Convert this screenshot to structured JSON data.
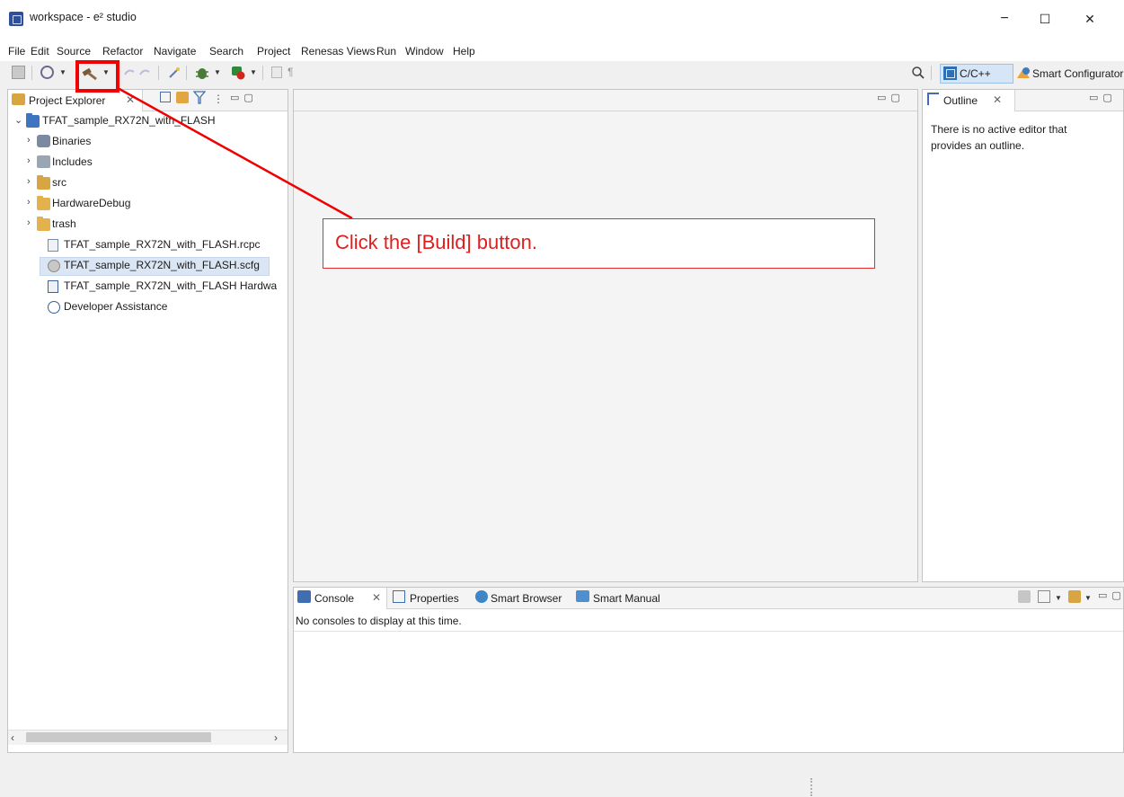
{
  "window": {
    "title": "workspace - e² studio",
    "controls": {
      "minimize": "−",
      "maximize": "☐",
      "close": "✕"
    }
  },
  "menu": [
    "File",
    "Edit",
    "Source",
    "Refactor",
    "Navigate",
    "Search",
    "Project",
    "Renesas Views",
    "Run",
    "Window",
    "Help"
  ],
  "toolbar": {
    "icons": [
      "save-icon",
      "manage-configurations-icon",
      "build-hammer-icon",
      "undo-icon",
      "redo-icon",
      "search-wand-icon",
      "debug-bug-icon",
      "run-icon",
      "pin-icon",
      "pilcrow-icon"
    ],
    "pilcrow": "¶",
    "perspective_cpp": "C/C++",
    "perspective_smart": "Smart Configurator",
    "colors": {
      "cpp_bg": "#d6e6f7",
      "accent": "#2f6fb3"
    }
  },
  "project_explorer": {
    "tab_label": "Project Explorer",
    "tree": {
      "root": "TFAT_sample_RX72N_with_FLASH",
      "items": [
        {
          "label": "Binaries",
          "icon": "binaries-icon",
          "expandable": true
        },
        {
          "label": "Includes",
          "icon": "includes-icon",
          "expandable": true
        },
        {
          "label": "src",
          "icon": "src-folder-icon",
          "expandable": true
        },
        {
          "label": "HardwareDebug",
          "icon": "folder-icon",
          "expandable": true
        },
        {
          "label": "trash",
          "icon": "folder-icon",
          "expandable": true
        },
        {
          "label": "TFAT_sample_RX72N_with_FLASH.rcpc",
          "icon": "file-icon",
          "expandable": false
        },
        {
          "label": "TFAT_sample_RX72N_with_FLASH.scfg",
          "icon": "gear-file-icon",
          "expandable": false,
          "selected": true
        },
        {
          "label": "TFAT_sample_RX72N_with_FLASH Hardwa",
          "icon": "launch-file-icon",
          "expandable": false
        },
        {
          "label": "Developer Assistance",
          "icon": "help-icon",
          "expandable": false
        }
      ]
    }
  },
  "outline": {
    "tab_label": "Outline",
    "message_line1": "There is no active editor that",
    "message_line2": "provides an outline."
  },
  "bottom_panel": {
    "tabs": [
      "Console",
      "Properties",
      "Smart Browser",
      "Smart Manual"
    ],
    "console_message": "No consoles to display at this time."
  },
  "annotation": {
    "callout": "Click the [Build] button.",
    "color": "#e52b2b"
  }
}
